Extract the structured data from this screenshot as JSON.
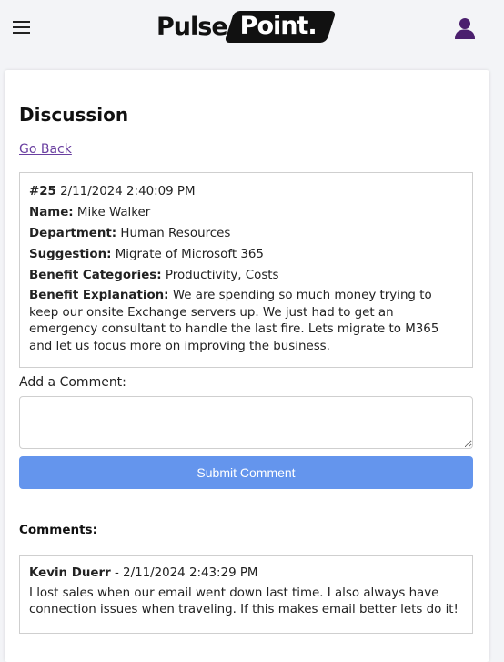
{
  "header": {
    "logo_left": "Pulse",
    "logo_right": "Point."
  },
  "main": {
    "title": "Discussion",
    "go_back": "Go Back"
  },
  "suggestion": {
    "number": "#25",
    "datetime": "2/11/2024 2:40:09 PM",
    "name_label": "Name:",
    "name": "Mike Walker",
    "department_label": "Department:",
    "department": "Human Resources",
    "suggestion_label": "Suggestion:",
    "suggestion": "Migrate of Microsoft 365",
    "categories_label": "Benefit Categories:",
    "categories": "Productivity, Costs",
    "explanation_label": "Benefit Explanation:",
    "explanation": "We are spending so much money trying to keep our onsite Exchange servers up. We just had to get an emergency consultant to handle the last fire. Lets migrate to M365 and let us focus more on improving the business."
  },
  "comment_form": {
    "label": "Add a Comment:",
    "value": "",
    "submit_label": "Submit Comment"
  },
  "comments": {
    "heading": "Comments:",
    "items": [
      {
        "author": "Kevin Duerr",
        "separator": " - ",
        "datetime": "2/11/2024 2:43:29 PM",
        "text": "I lost sales when our email went down last time. I also always have connection issues when traveling. If this makes email better lets do it!"
      }
    ]
  },
  "colors": {
    "accent_purple": "#6a3fa0",
    "submit_blue": "#6495ed",
    "background": "#f3f4f7"
  },
  "icons": [
    "hamburger-menu-icon",
    "user-icon",
    "resize-handle-icon"
  ]
}
